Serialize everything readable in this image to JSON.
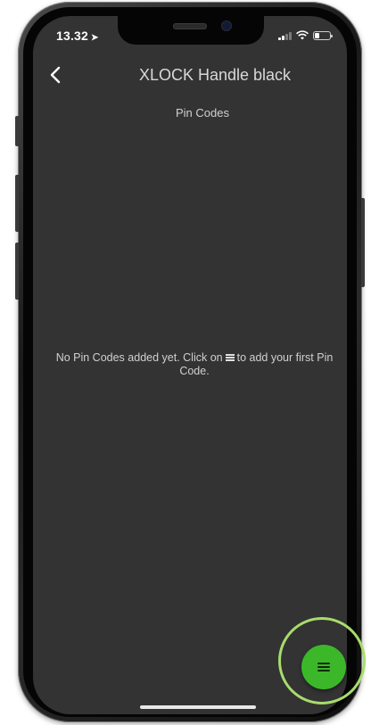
{
  "status_bar": {
    "time": "13.32",
    "location_icon": "location-arrow-icon",
    "signal_icon": "signal-bars-icon",
    "wifi_icon": "wifi-icon",
    "battery_icon": "battery-icon",
    "battery_level": 0.3
  },
  "header": {
    "back_icon": "chevron-left-icon",
    "title": "XLOCK Handle black",
    "subtitle": "Pin Codes"
  },
  "empty_state": {
    "text_before_icon": "No Pin Codes added yet. Click on",
    "inline_icon": "menu-icon",
    "text_after_icon": "to add your first Pin Code."
  },
  "fab": {
    "icon": "menu-icon",
    "color": "#3cb72a",
    "highlight_color": "#a8dc6c"
  },
  "colors": {
    "screen_background": "#333333",
    "text": "#d0d0d0"
  }
}
